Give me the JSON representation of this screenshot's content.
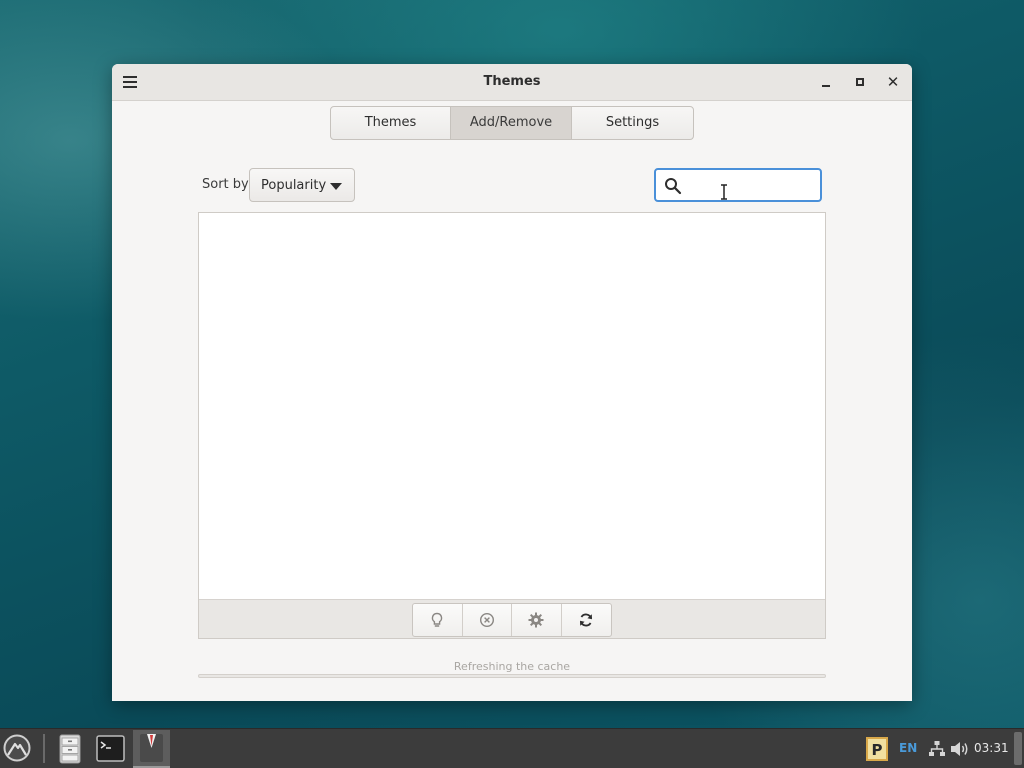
{
  "window": {
    "title": "Themes",
    "menu_icon": "hamburger-menu-icon",
    "controls": [
      "minimize-icon",
      "maximize-icon",
      "close-icon"
    ]
  },
  "tabs": [
    {
      "label": "Themes",
      "active": false
    },
    {
      "label": "Add/Remove",
      "active": true
    },
    {
      "label": "Settings",
      "active": false
    }
  ],
  "sort": {
    "label": "Sort by",
    "selected": "Popularity"
  },
  "search": {
    "value": "",
    "placeholder": "",
    "icon": "search-icon",
    "accent_color": "#4a90d9"
  },
  "list": {
    "items": [],
    "toolbar": [
      "lightbulb-icon",
      "remove-circle-icon",
      "gear-icon",
      "refresh-icon"
    ]
  },
  "status": {
    "text": "Refreshing the cache"
  },
  "taskbar": {
    "launcher_icon": "app-launcher-icon",
    "apps": [
      "file-cabinet-icon",
      "terminal-icon",
      "active-app-icon"
    ],
    "tray": {
      "p_icon": "p-indicator-icon",
      "language": "EN",
      "network_icon": "network-icon",
      "volume_icon": "volume-icon",
      "time": "03:31"
    }
  }
}
